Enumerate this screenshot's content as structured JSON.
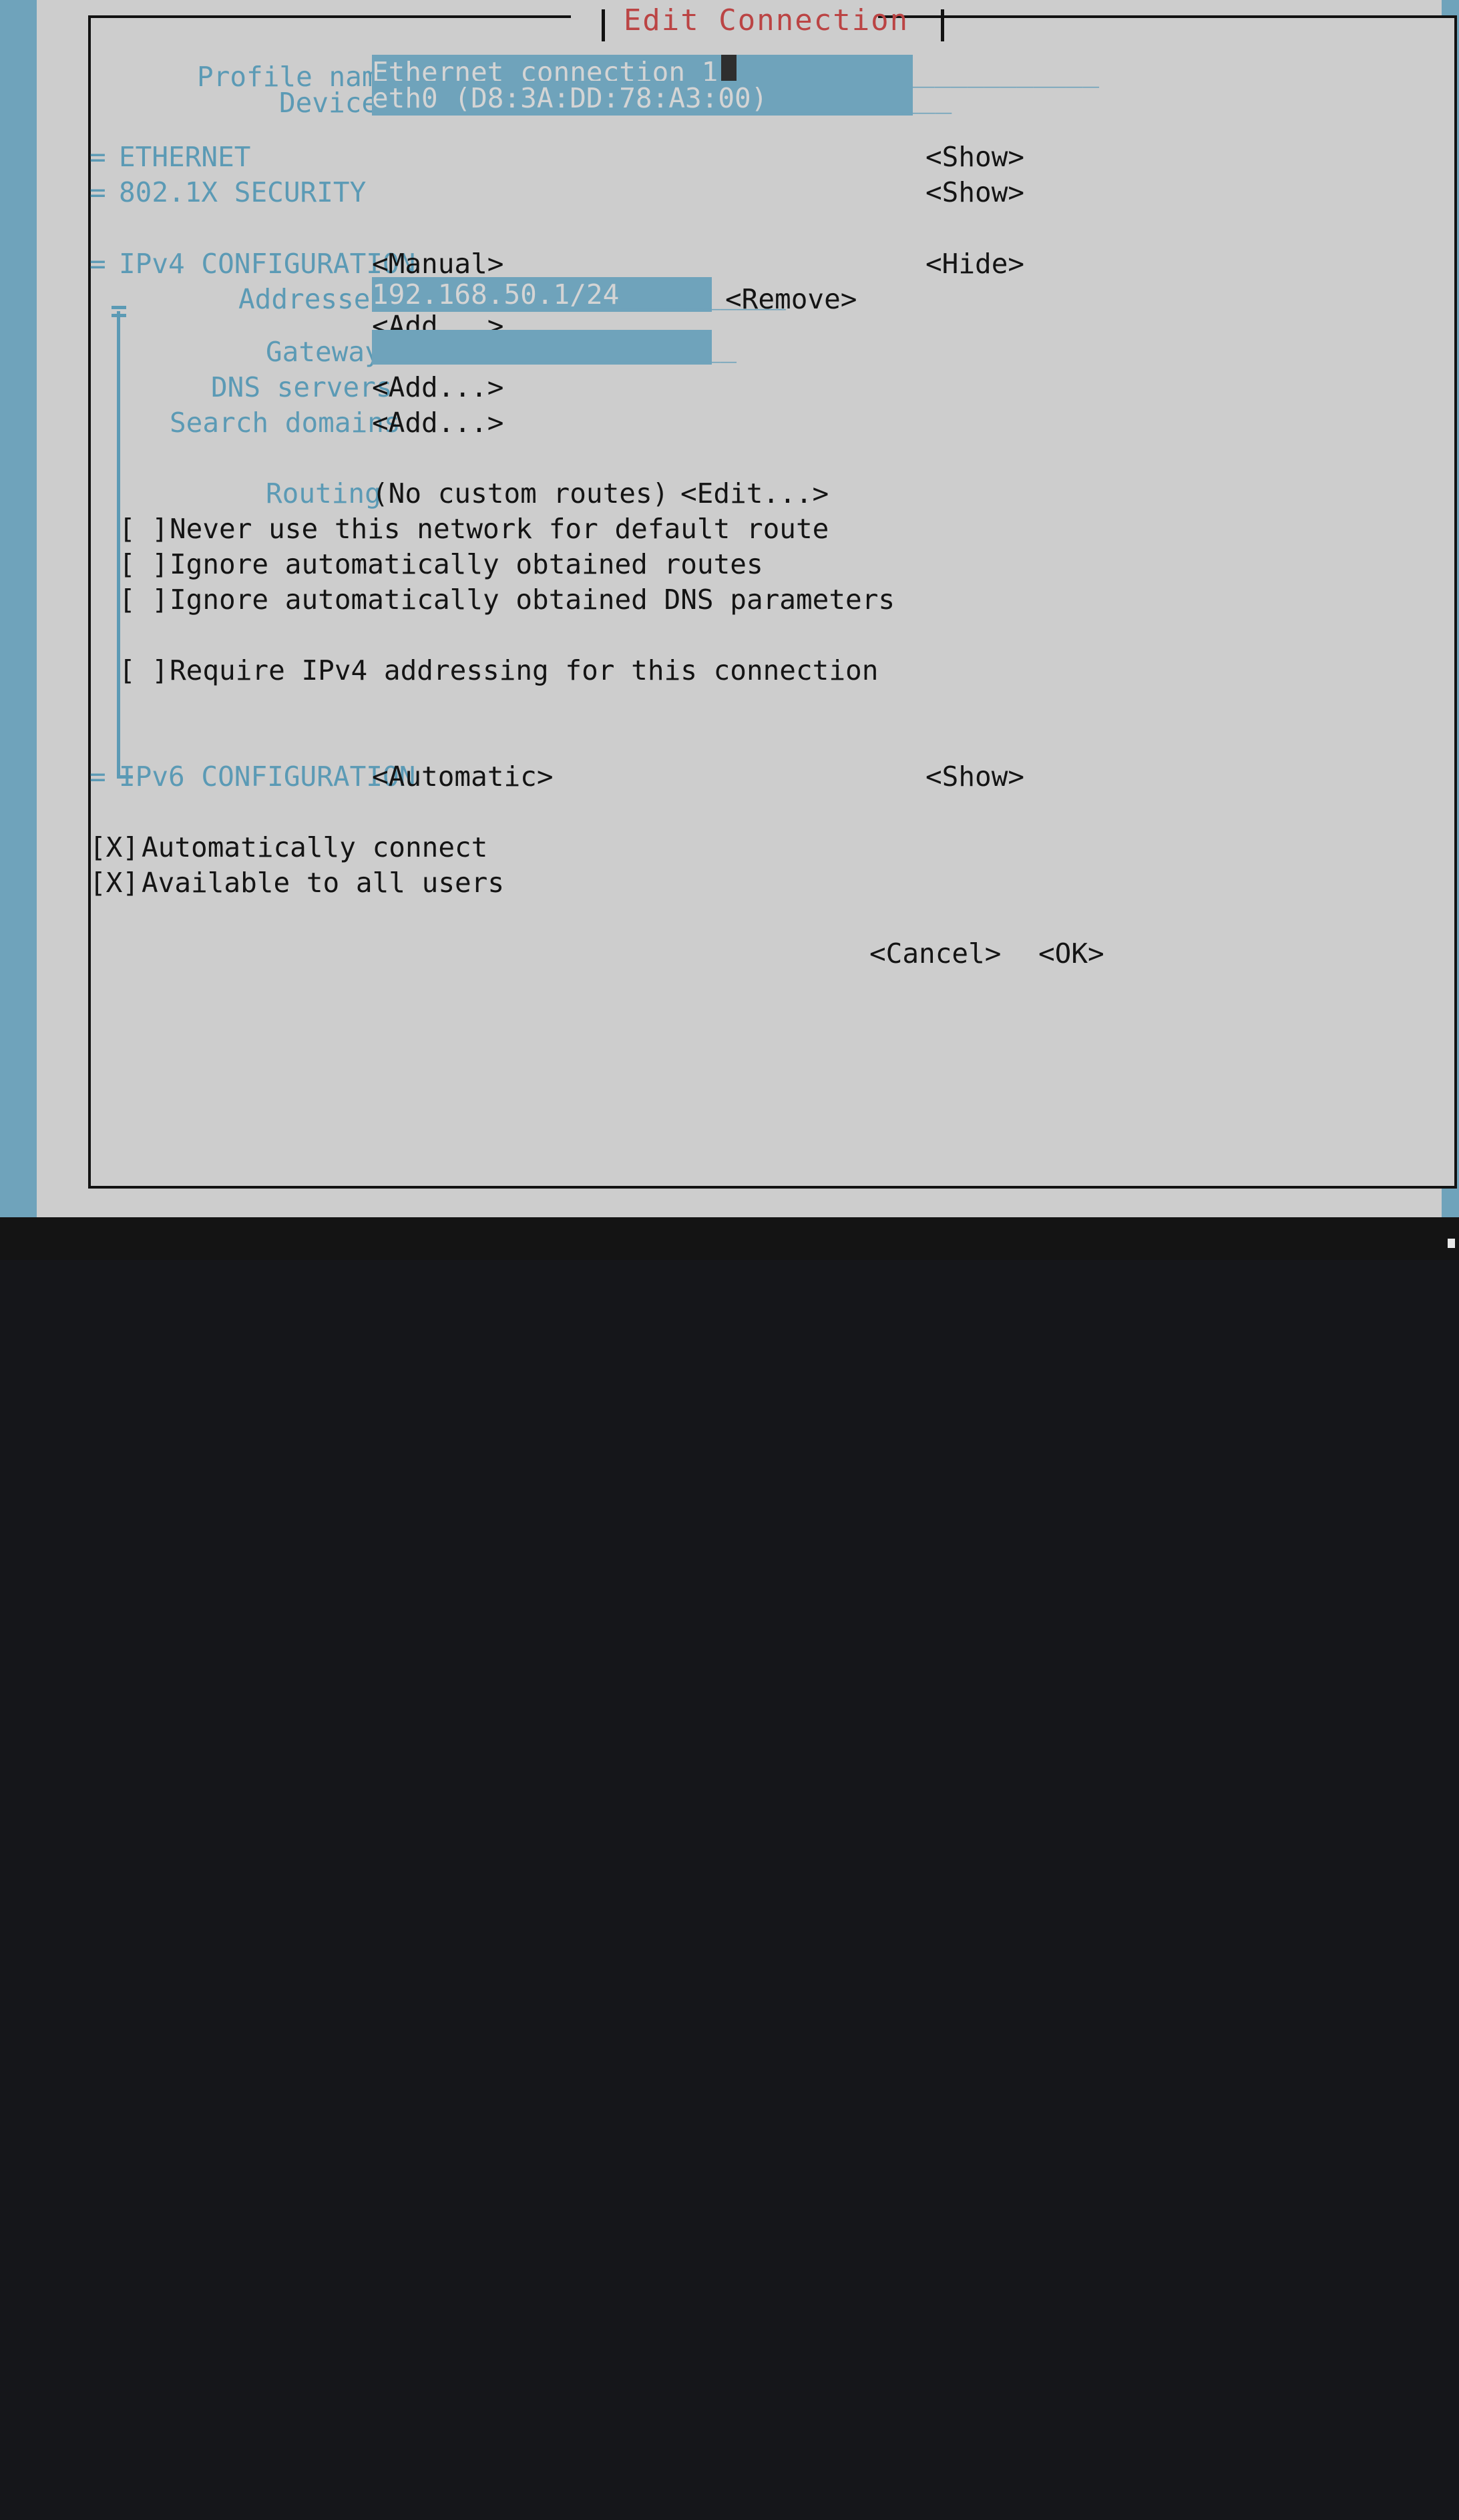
{
  "window": {
    "title": "Edit Connection",
    "title_color": "#bb4444",
    "bg_color": "#cdcdcd",
    "accent_color": "#6fa3bb",
    "label_color": "#5b9ab5"
  },
  "form": {
    "profile_name": {
      "label": "Profile name",
      "value": "Ethernet connection 1",
      "underline": "______________________"
    },
    "device": {
      "label": "Device",
      "value": "eth0 (D8:3A:DD:78:A3:00)",
      "underline": "_______________"
    }
  },
  "sections": [
    {
      "marker": "=",
      "name": "ETHERNET",
      "value": "",
      "toggle": "<Show>"
    },
    {
      "marker": "=",
      "name": "802.1X SECURITY",
      "value": "",
      "toggle": "<Show>"
    }
  ],
  "ipv4": {
    "marker": "=",
    "name": "IPv4 CONFIGURATION",
    "method": "<Manual>",
    "toggle": "<Hide>",
    "addresses": {
      "label": "Addresses",
      "value": "192.168.50.1/24",
      "underline": "__________",
      "remove_label": "<Remove>",
      "add_label": "<Add...>"
    },
    "gateway": {
      "label": "Gateway",
      "value": "",
      "underline": "______________________"
    },
    "dns_servers": {
      "label": "DNS servers",
      "add_label": "<Add...>"
    },
    "search_domains": {
      "label": "Search domains",
      "add_label": "<Add...>"
    },
    "routing": {
      "label": "Routing",
      "value": "(No custom routes)",
      "edit_label": "<Edit...>"
    },
    "checkboxes": [
      {
        "state": "[ ]",
        "label": "Never use this network for default route"
      },
      {
        "state": "[ ]",
        "label": "Ignore automatically obtained routes"
      },
      {
        "state": "[ ]",
        "label": "Ignore automatically obtained DNS parameters"
      }
    ],
    "require_ipv4": {
      "state": "[ ]",
      "label": "Require IPv4 addressing for this connection"
    }
  },
  "ipv6": {
    "marker": "=",
    "name": "IPv6 CONFIGURATION",
    "method": "<Automatic>",
    "toggle": "<Show>"
  },
  "global_checkboxes": [
    {
      "state": "[X]",
      "label": "Automatically connect"
    },
    {
      "state": "[X]",
      "label": "Available to all users"
    }
  ],
  "buttons": {
    "cancel": "<Cancel>",
    "ok": "<OK>"
  }
}
